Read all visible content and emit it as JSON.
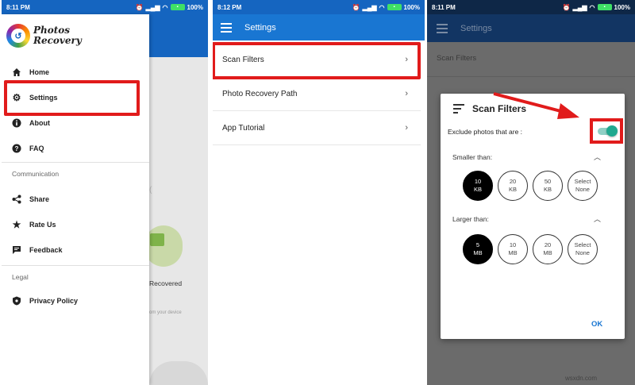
{
  "phone1": {
    "status": {
      "time": "8:11 PM",
      "battery": "100%"
    },
    "logo": {
      "line1": "Photos",
      "line2": "Recovery"
    },
    "menu": [
      {
        "label": "Home",
        "icon": "home-icon"
      },
      {
        "label": "Settings",
        "icon": "gear-icon"
      },
      {
        "label": "About",
        "icon": "info-icon"
      },
      {
        "label": "FAQ",
        "icon": "help-icon"
      }
    ],
    "section_communication": "Communication",
    "communication": [
      {
        "label": "Share",
        "icon": "share-icon"
      },
      {
        "label": "Rate Us",
        "icon": "star-icon"
      },
      {
        "label": "Feedback",
        "icon": "feedback-icon"
      }
    ],
    "section_legal": "Legal",
    "legal": [
      {
        "label": "Privacy Policy",
        "icon": "shield-icon"
      }
    ],
    "background_text": "Recovered",
    "background_subtext": "om your device",
    "highlight_color": "#e11b1b"
  },
  "phone2": {
    "status": {
      "time": "8:12 PM",
      "battery": "100%"
    },
    "title": "Settings",
    "rows": [
      {
        "label": "Scan Filters"
      },
      {
        "label": "Photo Recovery Path"
      },
      {
        "label": "App Tutorial"
      }
    ],
    "accent": "#1976d2"
  },
  "phone3": {
    "status": {
      "time": "8:11 PM",
      "battery": "100%"
    },
    "title": "Settings",
    "background_rows": [
      "Scan Filters"
    ],
    "dialog": {
      "title": "Scan Filters",
      "exclude_label": "Exclude photos that are :",
      "exclude_enabled": true,
      "smaller_label": "Smaller than:",
      "smaller_options": [
        {
          "line1": "10",
          "line2": "KB",
          "selected": true
        },
        {
          "line1": "20",
          "line2": "KB",
          "selected": false
        },
        {
          "line1": "50",
          "line2": "KB",
          "selected": false
        },
        {
          "line1": "Select",
          "line2": "None",
          "selected": false
        }
      ],
      "larger_label": "Larger than:",
      "larger_options": [
        {
          "line1": "5",
          "line2": "MB",
          "selected": true
        },
        {
          "line1": "10",
          "line2": "MB",
          "selected": false
        },
        {
          "line1": "20",
          "line2": "MB",
          "selected": false
        },
        {
          "line1": "Select",
          "line2": "None",
          "selected": false
        }
      ],
      "ok_label": "OK",
      "toggle_color": "#1fa88f"
    }
  },
  "watermark": "wsxdn.com"
}
